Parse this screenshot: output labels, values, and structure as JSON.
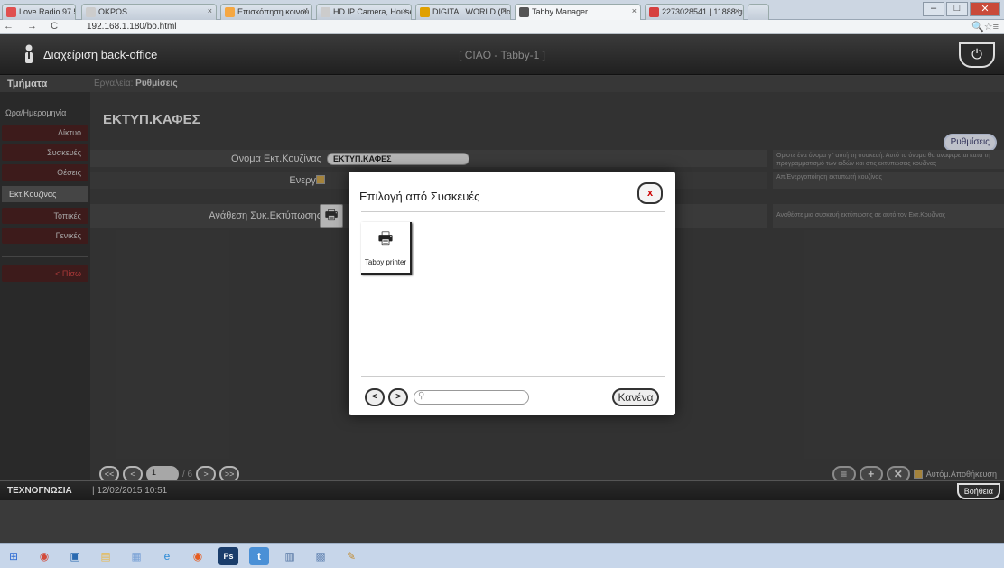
{
  "browser": {
    "tabs": [
      {
        "label": "Love Radio 97.5",
        "color": "#e05050"
      },
      {
        "label": "OKPOS",
        "color": "#cccccc"
      },
      {
        "label": "Επισκόπηση κοινού - Goo",
        "color": "#f5a742"
      },
      {
        "label": "HD IP Camera, Househol",
        "color": "#cccccc"
      },
      {
        "label": "DIGITAL WORLD (Παρθεν",
        "color": "#e0a000"
      },
      {
        "label": "Tabby Manager",
        "color": "#555555"
      },
      {
        "label": "2273028541 | 11888.gr",
        "color": "#d64040"
      }
    ],
    "url": "192.168.1.180/bo.html",
    "nav_glyphs": "← → C",
    "right_glyphs": "🔍☆≡"
  },
  "app": {
    "title": "Διαχείριση back-office",
    "center": "[ CIAO - Tabby-1 ]",
    "power_glyph": "⏻"
  },
  "crumb": {
    "section": "Τμήματα",
    "prefix": "Εργαλεία:",
    "current": "Ρυθμίσεις"
  },
  "sidebar": {
    "items": [
      {
        "label": "Ωρα/Ημερομηνία"
      },
      {
        "label": "Δίκτυο"
      },
      {
        "label": "Συσκευές"
      },
      {
        "label": "Θέσεις"
      },
      {
        "label": "Εκτ.Κουζίνας"
      },
      {
        "label": "Τοπικές"
      },
      {
        "label": "Γενικές"
      },
      {
        "label": "< Πίσω"
      }
    ]
  },
  "main": {
    "title": "ΕΚΤΥΠ.ΚΑΦΕΣ",
    "settings_btn": "Ρυθμίσεις",
    "rows": [
      {
        "label": "Ονομα Εκτ.Κουζίνας",
        "value": "ΕΚΤΥΠ.ΚΑΦΕΣ",
        "help": "Ορίστε ένα όνομα γι' αυτή τη συσκευή. Αυτό το όνομα θα αναφέρεται κατά τη προγραμματισμό των ειδών και στις εκτυπώσεις κουζίνας"
      },
      {
        "label": "Ενεργό",
        "help": "Απ/Ενεργοποίηση εκτυπωτή κουζίνας"
      },
      {
        "label": "Ανάθεση Συκ.Εκτύπωσης",
        "help": "Αναθέστε μια συσκευή εκτύπωσης σε αυτό τον Εκτ.Κουζίνας"
      }
    ],
    "pager": {
      "first": "<<",
      "prev": "<",
      "page": "1",
      "total": "/ 6",
      "next": ">",
      "last": ">>"
    },
    "actions": {
      "list": "≡",
      "add": "+",
      "del": "✕",
      "autosave": "Αυτόμ.Αποθήκευση"
    }
  },
  "modal": {
    "title": "Επιλογή από Συσκευές",
    "close": "x",
    "device_label": "Tabby printer",
    "prev": "<",
    "next": ">",
    "none_btn": "Κανένα"
  },
  "footer": {
    "brand": "ΤΕΧΝΟΓΝΩΣΙΑ",
    "datetime": "| 12/02/2015 10:51",
    "help": "Βοήθεια"
  },
  "taskbar": {
    "icons": [
      {
        "name": "start-icon",
        "glyph": "⊞",
        "color": "#2d6bd3"
      },
      {
        "name": "chrome-icon",
        "glyph": "◉",
        "color": "#d24a3a"
      },
      {
        "name": "app-icon",
        "glyph": "▣",
        "color": "#2a6ab0"
      },
      {
        "name": "explorer-icon",
        "glyph": "▤",
        "color": "#e8b84a"
      },
      {
        "name": "network-icon",
        "glyph": "▦",
        "color": "#7aa2d6"
      },
      {
        "name": "ie-icon",
        "glyph": "e",
        "color": "#2a8ad6"
      },
      {
        "name": "chrome2-icon",
        "glyph": "◉",
        "color": "#e65c20"
      },
      {
        "name": "photoshop-icon",
        "glyph": "Ps",
        "color": "#1a3d6b"
      },
      {
        "name": "notes-icon",
        "glyph": "t",
        "color": "#4a90d6"
      },
      {
        "name": "window-icon",
        "glyph": "▥",
        "color": "#5a7aa6"
      },
      {
        "name": "monitor-icon",
        "glyph": "▩",
        "color": "#6a8ab6"
      },
      {
        "name": "paint-icon",
        "glyph": "✎",
        "color": "#c08a30"
      }
    ]
  }
}
